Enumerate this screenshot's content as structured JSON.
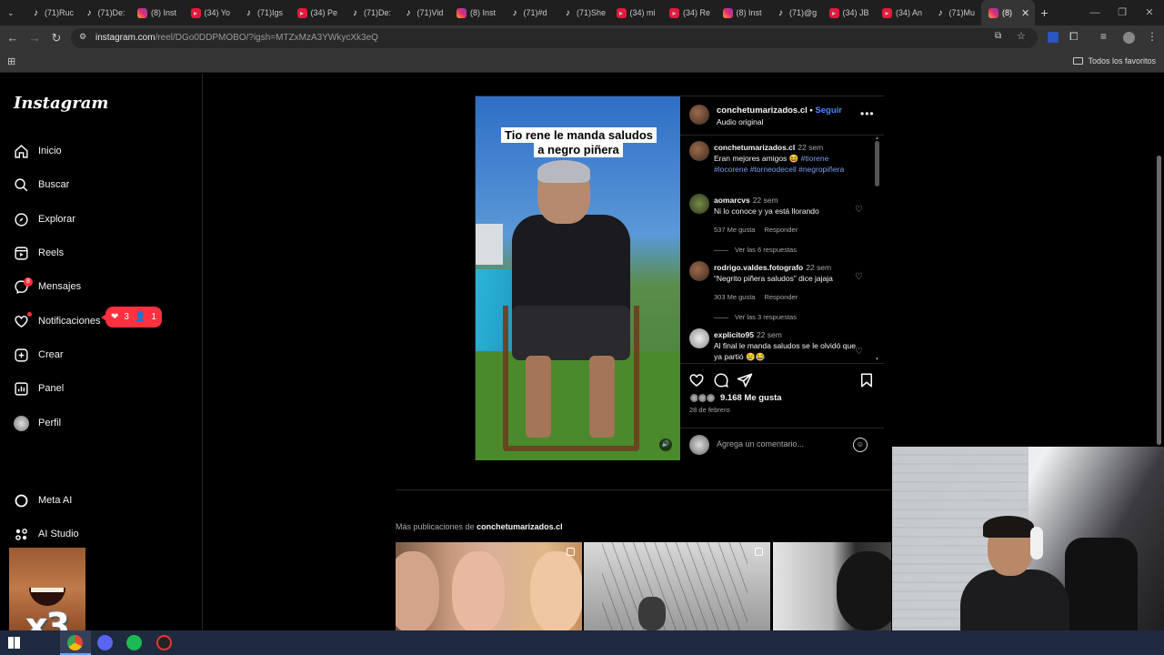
{
  "browser": {
    "tabs": [
      {
        "icon": "tiktok",
        "label": "(71)Ruc"
      },
      {
        "icon": "tiktok",
        "label": "(71)De:"
      },
      {
        "icon": "instagram",
        "label": "(8) Inst"
      },
      {
        "icon": "youtube",
        "label": "(34) Yo"
      },
      {
        "icon": "tiktok",
        "label": "(71)Igs"
      },
      {
        "icon": "youtube",
        "label": "(34) Pe"
      },
      {
        "icon": "tiktok",
        "label": "(71)De:"
      },
      {
        "icon": "tiktok",
        "label": "(71)Vid"
      },
      {
        "icon": "instagram",
        "label": "(8) Inst"
      },
      {
        "icon": "tiktok",
        "label": "(71)#d"
      },
      {
        "icon": "tiktok",
        "label": "(71)She"
      },
      {
        "icon": "youtube",
        "label": "(34) mi"
      },
      {
        "icon": "youtube",
        "label": "(34) Re"
      },
      {
        "icon": "instagram",
        "label": "(8) Inst"
      },
      {
        "icon": "tiktok",
        "label": "(71)@g"
      },
      {
        "icon": "youtube",
        "label": "(34) JB"
      },
      {
        "icon": "youtube",
        "label": "(34) An"
      },
      {
        "icon": "tiktok",
        "label": "(71)Mu"
      },
      {
        "icon": "instagram",
        "label": "(8)",
        "active": true
      }
    ],
    "url_host": "instagram.com",
    "url_path": "/reel/DGo0DDPMOBO/?igsh=MTZxMzA3YWkycXk3eQ",
    "bookmarks_folder": "Todos los favoritos"
  },
  "instagram": {
    "logo": "Instagram",
    "nav": {
      "home": "Inicio",
      "search": "Buscar",
      "explore": "Explorar",
      "reels": "Reels",
      "messages": "Mensajes",
      "notifications": "Notificaciones",
      "create": "Crear",
      "dashboard": "Panel",
      "profile": "Perfil",
      "meta_ai": "Meta AI",
      "ai_studio": "AI Studio"
    },
    "messages_badge": "8",
    "notif_pill": {
      "likes": "3",
      "follows": "1"
    },
    "post": {
      "video_caption": "Tio rene le manda saludos a negro piñera",
      "username": "conchetumarizados.cl",
      "follow": "Seguir",
      "audio": "Audio original",
      "caption": {
        "user": "conchetumarizados.cl",
        "time": "22 sem",
        "text": "Eran mejores amigos 😆 ",
        "hashtags": "#tiorene #locorene #torneodecell #negropiñera"
      },
      "comments": [
        {
          "user": "aomarcvs",
          "time": "22 sem",
          "text": "Ni lo conoce y ya está llorando",
          "likes": "537 Me gusta",
          "reply": "Responder",
          "replies": "Ver las 6 respuestas"
        },
        {
          "user": "rodrigo.valdes.fotografo",
          "time": "22 sem",
          "text": "“Negrito piñera saludos” dice jajaja",
          "likes": "303 Me gusta",
          "reply": "Responder",
          "replies": "Ver las 3 respuestas"
        },
        {
          "user": "explicito95",
          "time": "22 sem",
          "text": "Al final le manda saludos se le olvidó que ya partió 😢😂"
        }
      ],
      "likes_count": "9.168 Me gusta",
      "date": "28 de febrero",
      "comment_placeholder": "Agrega un comentario..."
    },
    "more_posts_prefix": "Más publicaciones de ",
    "more_posts_user": "conchetumarizados.cl"
  },
  "overlay": {
    "meme_text": "x3"
  },
  "colors": {
    "accent_blue": "#4f87ff",
    "notification_red": "#ff3040",
    "background": "#000000"
  }
}
